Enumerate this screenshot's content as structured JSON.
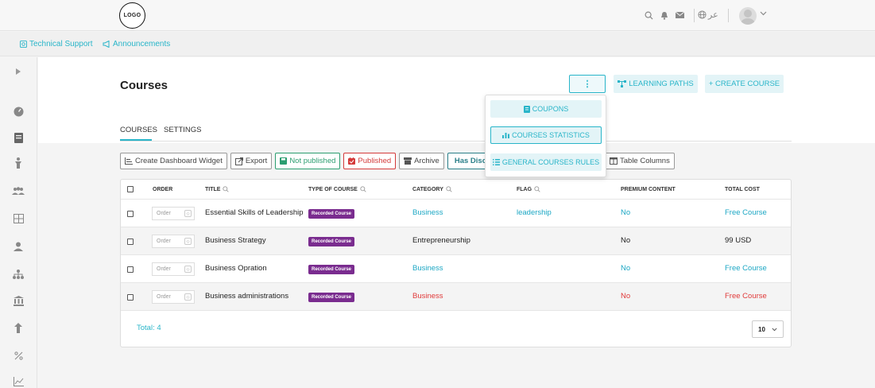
{
  "header": {
    "logo": "LOGO",
    "lang": "عر",
    "icons": [
      "search-icon",
      "bell-icon",
      "mail-icon",
      "globe-icon",
      "avatar",
      "chevron-down-icon"
    ]
  },
  "links": {
    "support": "Technical Support",
    "announcements": "Announcements"
  },
  "page": {
    "title": "Courses",
    "more": "⋮",
    "learning_paths": "LEARNING PATHS",
    "create_course": "+ CREATE COURSE"
  },
  "tabs": [
    "COURSES",
    "SETTINGS"
  ],
  "toolbar": {
    "dashboard_widget": "Create Dashboard Widget",
    "export": "Export",
    "not_published": "Not published",
    "published": "Published",
    "archive": "Archive",
    "has_discount": "Has Disc",
    "table_columns": "Table Columns"
  },
  "dropdown": {
    "coupons": "COUPONS",
    "statistics": "COURSES STATISTICS",
    "rules": "GENERAL COURSES RULES"
  },
  "table": {
    "headers": {
      "order": "ORDER",
      "title": "TITLE",
      "type": "TYPE OF COURSE",
      "category": "CATEGORY",
      "flag": "FLAG",
      "premium": "PREMIUM CONTENT",
      "cost": "TOTAL COST"
    },
    "order_placeholder": "Order",
    "rows": [
      {
        "title": "Essential Skills of Leadership",
        "type": "Recorded Course",
        "category": "Business",
        "flag": "leadership",
        "premium": "No",
        "cost": "Free Course"
      },
      {
        "title": "Business Strategy",
        "type": "Recorded Course",
        "category": "Entrepreneurship",
        "flag": "",
        "premium": "No",
        "cost": "99 USD"
      },
      {
        "title": "Business Opration",
        "type": "Recorded Course",
        "category": "Business",
        "flag": "",
        "premium": "No",
        "cost": "Free Course"
      },
      {
        "title": "Business administrations",
        "type": "Recorded Course",
        "category": "Business",
        "flag": "",
        "premium": "No",
        "cost": "Free Course"
      }
    ],
    "total": "Total: 4",
    "page_size": "10"
  },
  "colors": {
    "accent": "#29b5c9",
    "badge": "#7a2c8f",
    "red": "#e03a3a"
  }
}
